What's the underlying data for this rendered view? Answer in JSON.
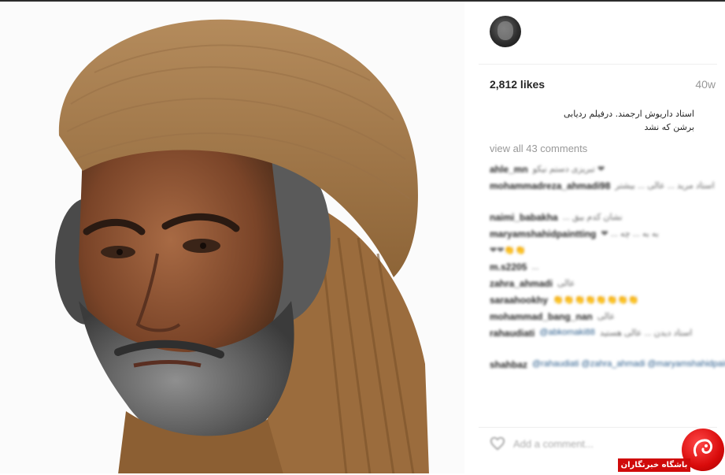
{
  "post": {
    "likes": "2,812 likes",
    "age": "40w",
    "caption_line1": "استاد داریوش ارجمند. درفیلم ردیابی",
    "caption_line2": "برشن که نشد",
    "view_all_comments": "view all 43 comments",
    "add_comment_placeholder": "Add a comment..."
  },
  "comments": [
    {
      "user": "ahle_mn",
      "text": "❤ تبریزی دستم نیکو"
    },
    {
      "user": "mohammadreza_ahmadi98",
      "text": "استاد مرید ... عالی ... بیشتر",
      "tall": true
    },
    {
      "user": "naimi_babakha",
      "text": "نشان کدم بیق ..."
    },
    {
      "user": "maryamshahidpaintting",
      "text": "به به ... چه ... ❤"
    },
    {
      "user": "",
      "text": "👏👏❤❤"
    },
    {
      "user": "m.s2205",
      "text": "..."
    },
    {
      "user": "zahra_ahmadi",
      "text": "عالی"
    },
    {
      "user": "saraahookhy",
      "text": "👏👏👏👏👏👏👏👏"
    },
    {
      "user": "mohammad_bang_nan",
      "text": "عالی"
    },
    {
      "user": "rahaudiati",
      "mention": "@abkomaki88",
      "text": "استاد دیدن ... عالی هستید",
      "tall": true
    },
    {
      "user": "shahbaz",
      "mention": "@rahaudiati @zahra_ahmadi @maryamshahidpaintting",
      "tall": true
    }
  ],
  "watermark": {
    "label": "باشگاه خبرنگاران"
  },
  "colors": {
    "accent_red": "#d00b0b",
    "muted_text": "#999999",
    "link_blue": "#2b5d8c"
  },
  "icons": {
    "like": "heart-outline-icon",
    "avatar": "profile-avatar"
  }
}
